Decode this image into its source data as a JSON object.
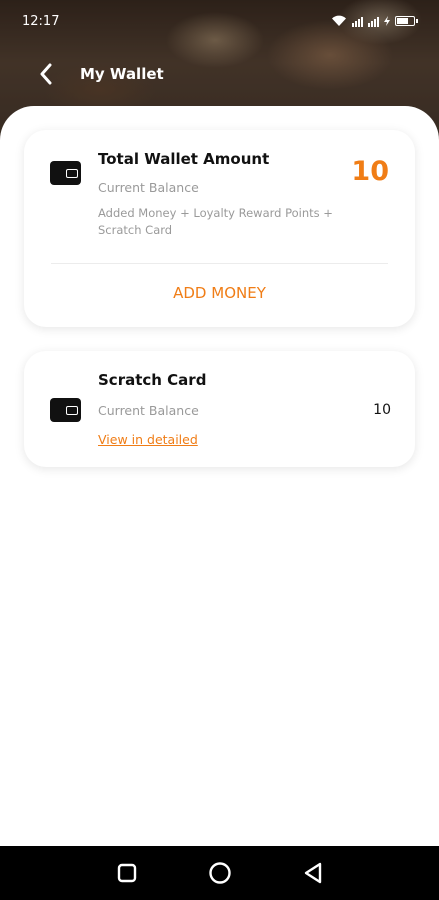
{
  "status_bar": {
    "time": "12:17"
  },
  "header": {
    "title": "My Wallet"
  },
  "total_wallet": {
    "title": "Total Wallet Amount",
    "subtitle": "Current Balance",
    "note": "Added Money + Loyalty Reward Points + Scratch Card",
    "amount": "10",
    "action_label": "ADD MONEY"
  },
  "scratch_card": {
    "title": "Scratch Card",
    "subtitle": "Current Balance",
    "amount": "10",
    "link_label": "View in detailed"
  },
  "colors": {
    "accent": "#f07d16",
    "text": "#111111",
    "muted": "#9a9a9a"
  },
  "icons": [
    "back-arrow-icon",
    "wifi-icon",
    "signal-icon",
    "battery-icon",
    "wallet-icon",
    "nav-recents-icon",
    "nav-home-icon",
    "nav-back-icon"
  ]
}
